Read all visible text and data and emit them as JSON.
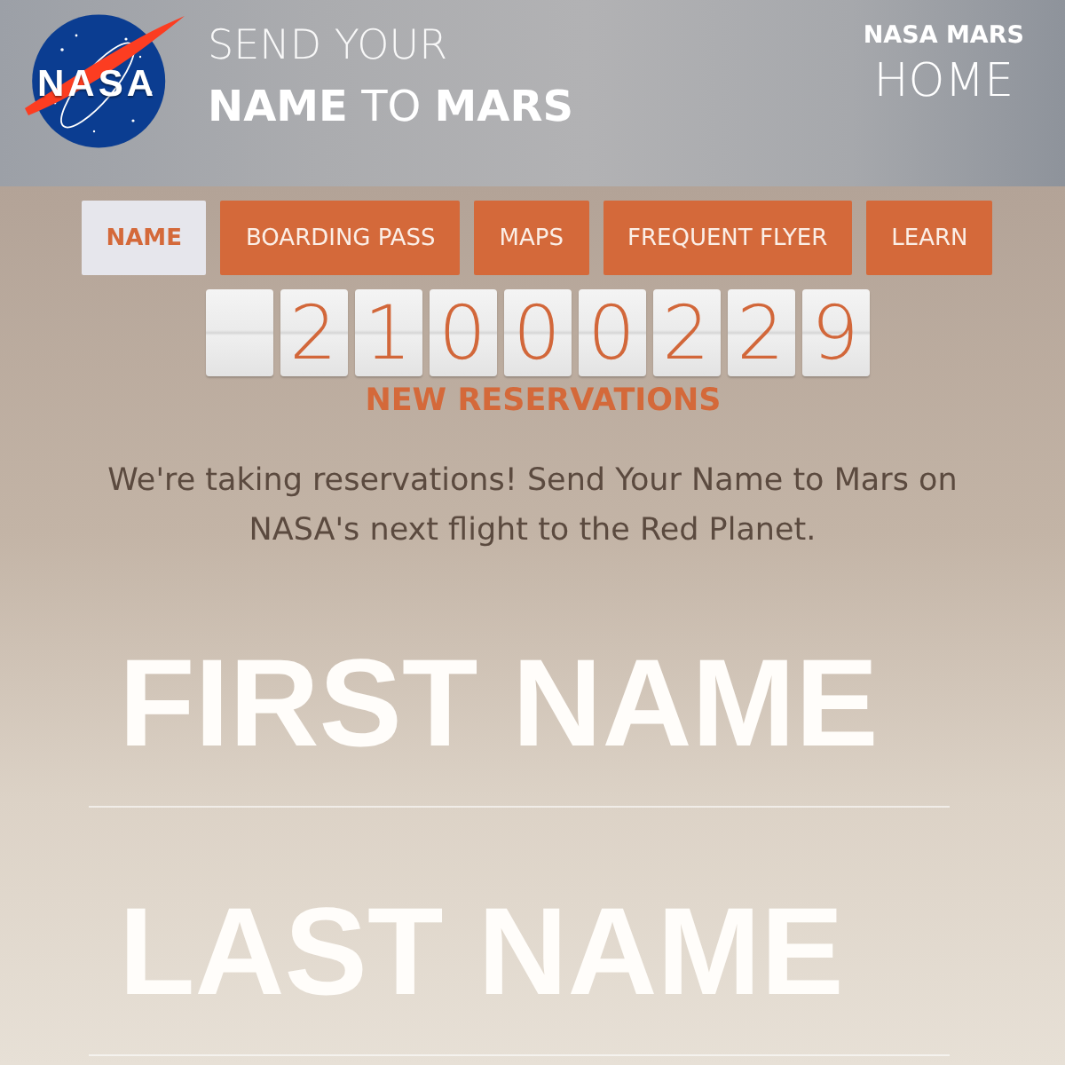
{
  "header": {
    "logo": {
      "wordmark": "NASA"
    },
    "title": {
      "line_1": "SEND YOUR",
      "line_2": "**NAME** TO **MARS**"
    },
    "home_link": {
      "eyebrow": "NASA MARS",
      "label": "HOME"
    }
  },
  "tabs": [
    {
      "label": "NAME",
      "selected": true
    },
    {
      "label": "BOARDING PASS",
      "selected": false
    },
    {
      "label": "MAPS",
      "selected": false
    },
    {
      "label": "FREQUENT FLYER",
      "selected": false
    },
    {
      "label": "LEARN",
      "selected": false
    }
  ],
  "counter": {
    "tiles": [
      {
        "kind": "blank"
      },
      {
        "kind": "digit",
        "digit": "2"
      },
      {
        "kind": "digit",
        "digit": "1"
      },
      {
        "kind": "digit",
        "digit": "0"
      },
      {
        "kind": "digit",
        "digit": "0"
      },
      {
        "kind": "digit",
        "digit": "0"
      },
      {
        "kind": "digit",
        "digit": "2"
      },
      {
        "kind": "digit",
        "digit": "2"
      },
      {
        "kind": "digit",
        "digit": "9"
      }
    ],
    "label": "NEW RESERVATIONS"
  },
  "intro": "We're taking reservations! Send Your Name to Mars on NASA's next flight to the Red Planet.",
  "form": {
    "fields": [
      {
        "placeholder": "FIRST NAME"
      },
      {
        "placeholder": "LAST NAME"
      }
    ]
  }
}
